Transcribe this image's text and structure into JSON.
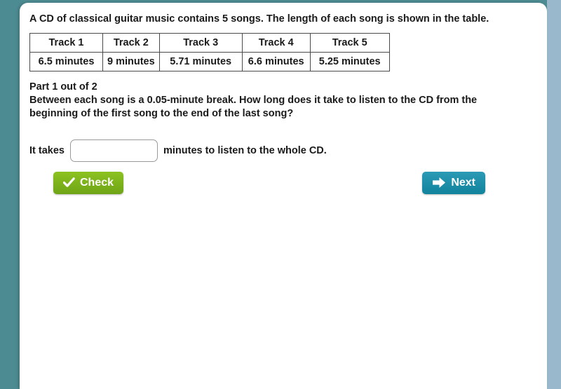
{
  "theme": {
    "page_background": "#4d8b92",
    "right_edge": "#9ab8cc",
    "panel_background": "#ffffff",
    "text_color": "#1a1a1a",
    "check_green": "#7ab51d",
    "next_teal": "#1a8fa8",
    "table_border": "#4a4a4a",
    "input_border": "#9a9a9a"
  },
  "problem": {
    "intro": "A CD of classical guitar music contains 5 songs. The length of each song is shown in the table."
  },
  "table": {
    "headers": [
      "Track 1",
      "Track 2",
      "Track 3",
      "Track 4",
      "Track 5"
    ],
    "values": [
      "6.5 minutes",
      "9 minutes",
      "5.71 minutes",
      "6.6 minutes",
      "5.25 minutes"
    ]
  },
  "part": {
    "label": "Part 1 out of 2",
    "question": "Between each song is a 0.05-minute break. How long does it take to listen to the CD from the beginning of the first song to the end of the last song?"
  },
  "answer": {
    "prefix": "It takes",
    "suffix": "minutes to listen to the whole CD.",
    "value": "",
    "placeholder": ""
  },
  "buttons": {
    "check_label": "Check",
    "check_icon": "checkmark-icon",
    "next_label": "Next",
    "next_icon": "arrow-right-icon"
  }
}
